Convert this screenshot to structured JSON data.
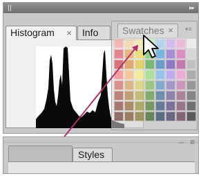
{
  "top_group": {
    "collapse_icon": "double-chevron-right-icon",
    "tabs": [
      {
        "label": "Histogram",
        "close": "×"
      },
      {
        "label": "Info"
      }
    ]
  },
  "swatches": {
    "tab_label": "Swatches",
    "close": "×",
    "menu_icon": "panel-menu-icon",
    "colors": [
      [
        "#ff9ea0",
        "#ffd7a0",
        "#fff3a0",
        "#b8ff9e",
        "#a0d7ff",
        "#d8b0ff",
        "#ffb0e0",
        "#ffffff"
      ],
      [
        "#e04a5e",
        "#f0a04a",
        "#f5e04a",
        "#6acf5a",
        "#4aa8e8",
        "#8e6ad8",
        "#e26ab8",
        "#dcdcdc"
      ],
      [
        "#c83040",
        "#e08830",
        "#e0c830",
        "#48a840",
        "#3080c8",
        "#6848b8",
        "#c04898",
        "#b8b8b8"
      ],
      [
        "#ff7878",
        "#ffb878",
        "#fff078",
        "#98e878",
        "#78b8ff",
        "#b898ff",
        "#ff98d8",
        "#989898"
      ],
      [
        "#d06058",
        "#d8a058",
        "#d8d058",
        "#80c058",
        "#5898c8",
        "#9078c8",
        "#c878b0",
        "#787878"
      ],
      [
        "#a04840",
        "#b07838",
        "#b0a838",
        "#589838",
        "#386898",
        "#685898",
        "#985878",
        "#585858"
      ],
      [
        "#803830",
        "#905828",
        "#908828",
        "#407828",
        "#284878",
        "#483878",
        "#784060",
        "#383838"
      ],
      [
        "#602820",
        "#704018",
        "#706818",
        "#305818",
        "#183058",
        "#302858",
        "#582848",
        "#181818"
      ]
    ]
  },
  "bottom_group": {
    "tabs": [
      {
        "label": ""
      },
      {
        "label": "Styles"
      }
    ],
    "controls": "– ≡"
  }
}
